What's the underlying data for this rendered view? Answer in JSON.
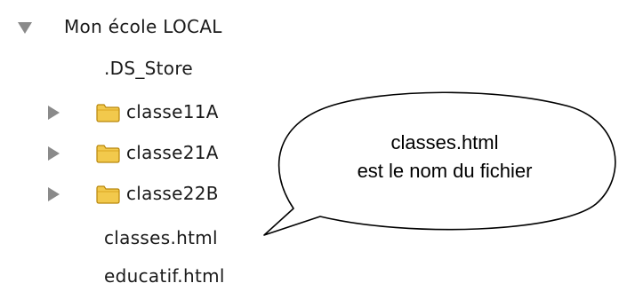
{
  "tree": {
    "root": {
      "label": "Mon école LOCAL",
      "expanded": true
    },
    "items": [
      {
        "label": ".DS_Store",
        "type": "file"
      },
      {
        "label": "classe11A",
        "type": "folder",
        "expanded": false
      },
      {
        "label": "classe21A",
        "type": "folder",
        "expanded": false
      },
      {
        "label": "classe22B",
        "type": "folder",
        "expanded": false
      },
      {
        "label": "classes.html",
        "type": "file"
      },
      {
        "label": "educatif.html",
        "type": "file"
      }
    ]
  },
  "callout": {
    "line1": "classes.html",
    "line2": "est le nom du fichier"
  },
  "colors": {
    "disclosure": "#8a8a8a",
    "folder_fill": "#f2c94c",
    "folder_stroke": "#b8860b"
  },
  "icons": {
    "disclosure_expanded": "triangle-down-icon",
    "disclosure_collapsed": "triangle-right-icon",
    "folder": "folder-icon"
  }
}
